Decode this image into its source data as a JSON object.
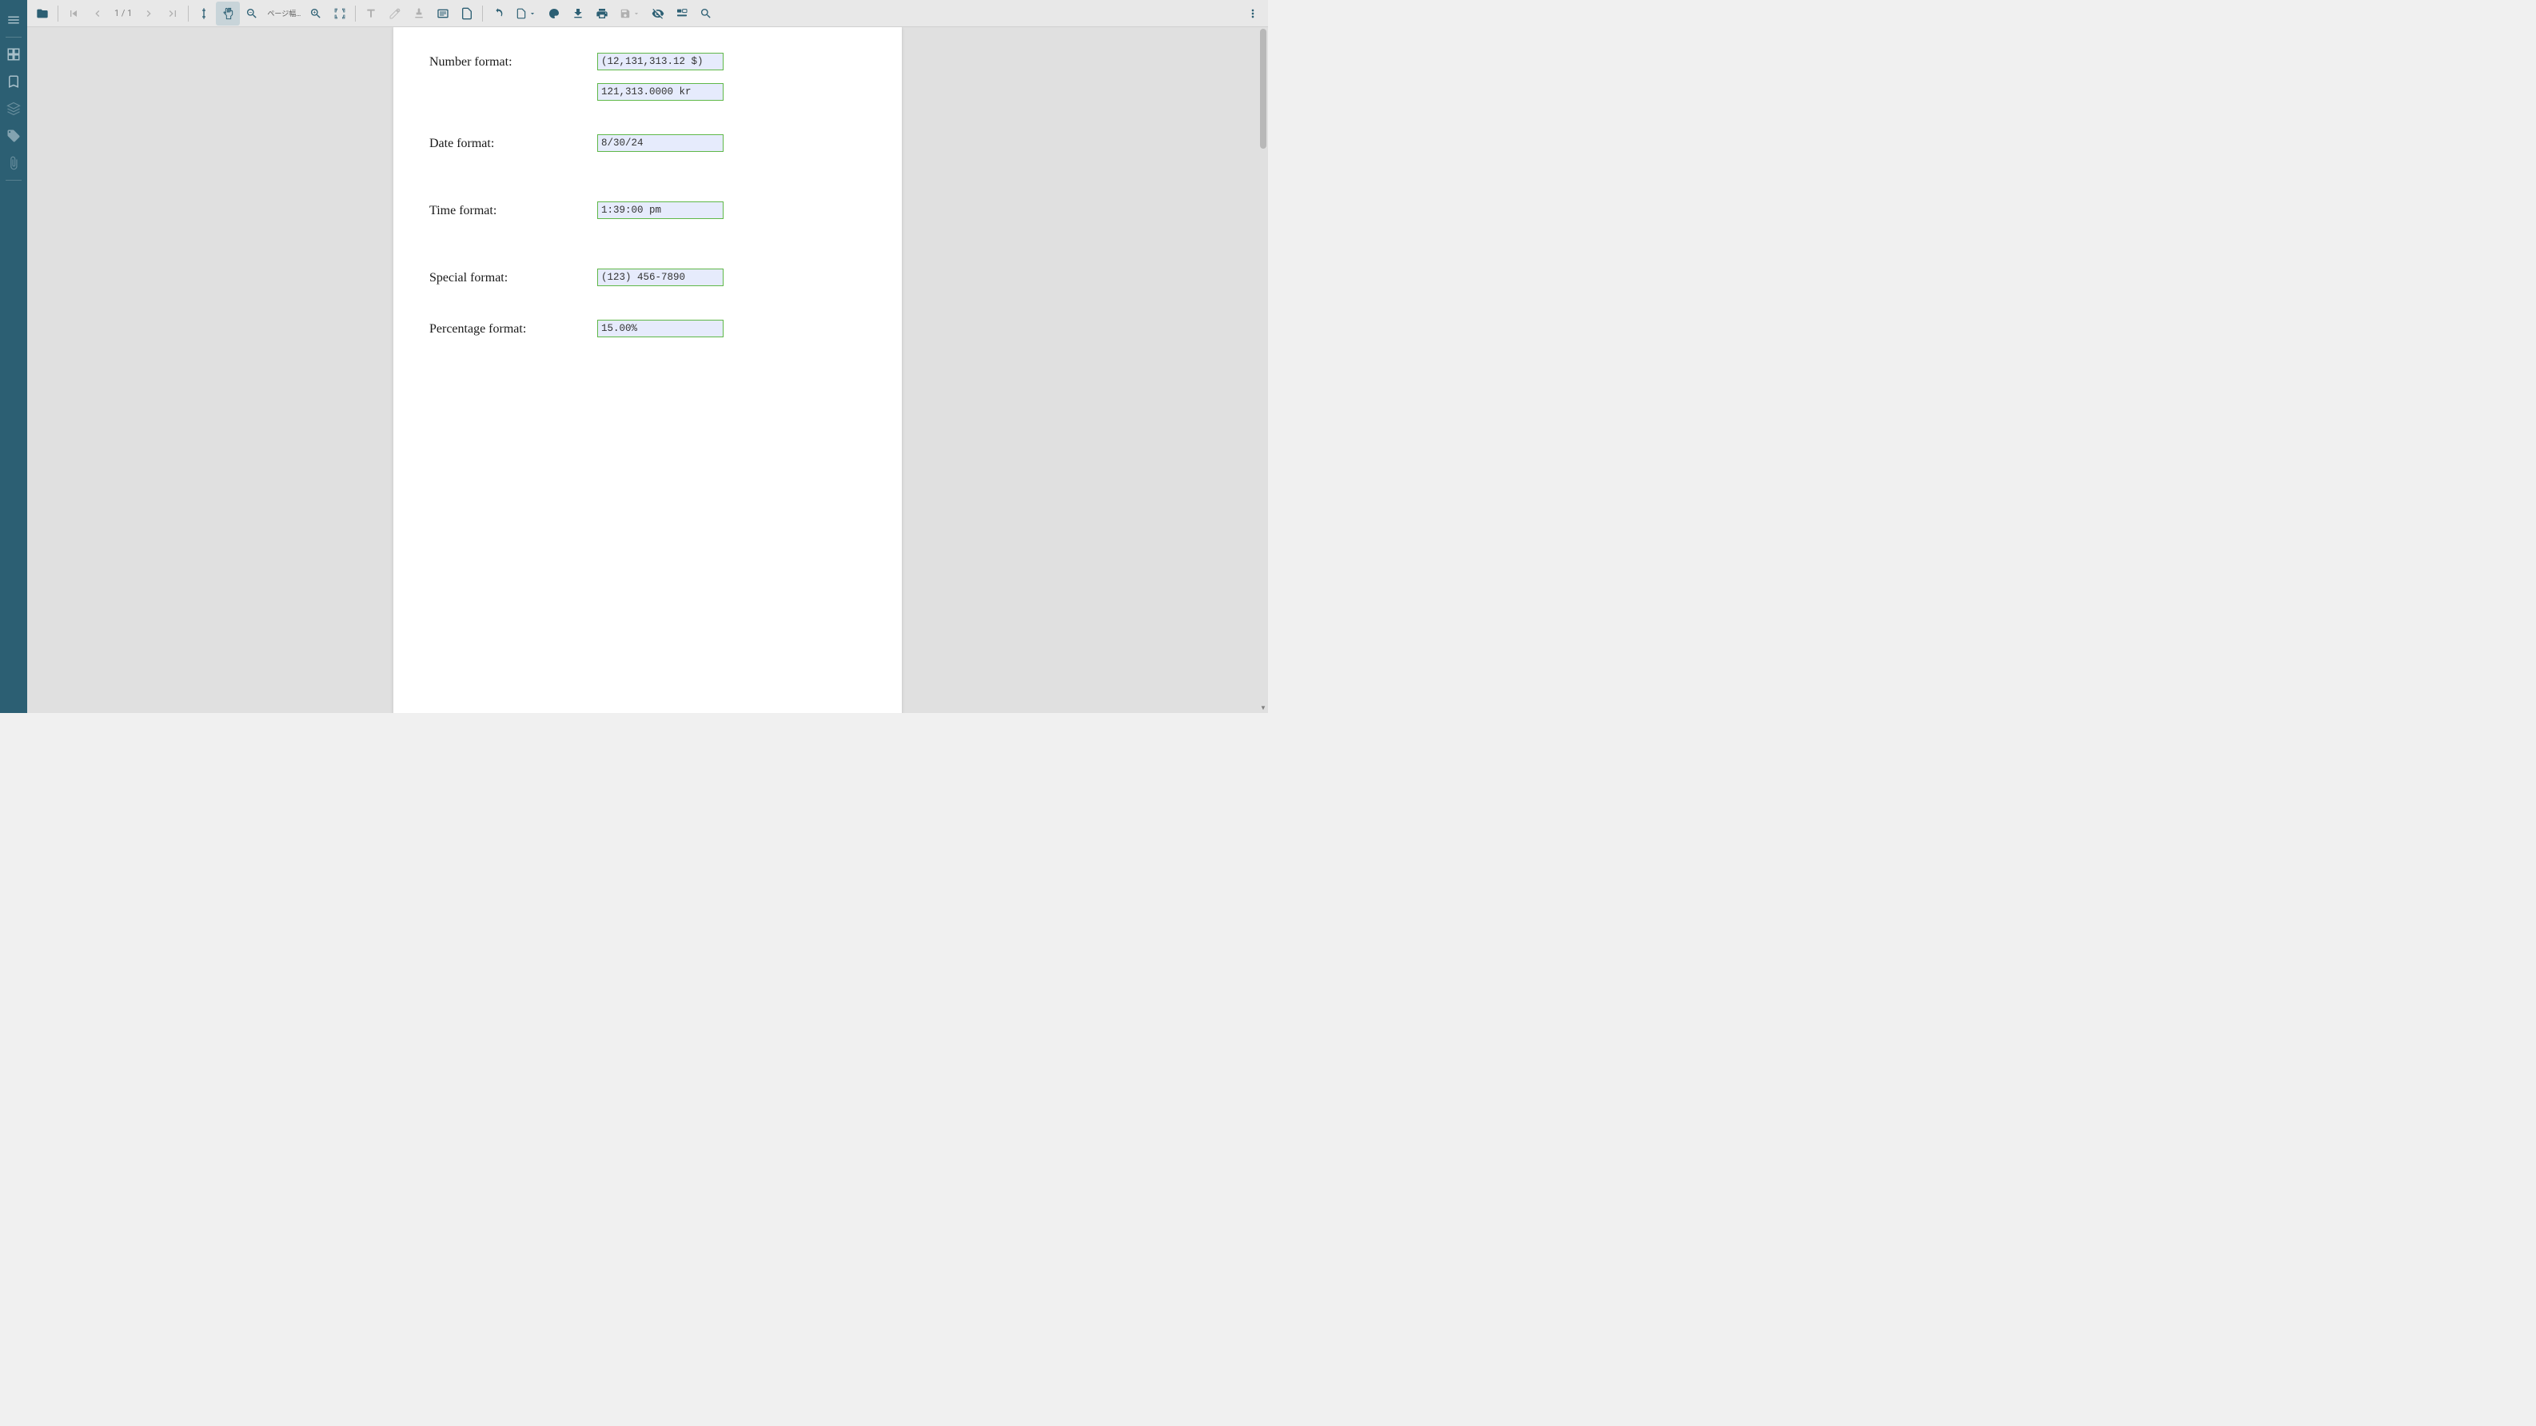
{
  "toolbar": {
    "page_indicator": "1 / 1",
    "zoom_mode": "ページ幅に合..."
  },
  "sidebar": {
    "items": [
      "menu",
      "panel",
      "bookmark",
      "layers",
      "tag",
      "attachment"
    ]
  },
  "form": {
    "rows": [
      {
        "label": "Number format:",
        "fields": [
          "(12,131,313.12 $)",
          "121,313.0000 kr"
        ]
      },
      {
        "label": "Date format:",
        "fields": [
          "8/30/24"
        ]
      },
      {
        "label": "Time format:",
        "fields": [
          "1:39:00 pm"
        ]
      },
      {
        "label": "Special format:",
        "fields": [
          "(123) 456-7890"
        ]
      },
      {
        "label": "Percentage format:",
        "fields": [
          "15.00%"
        ]
      }
    ]
  }
}
